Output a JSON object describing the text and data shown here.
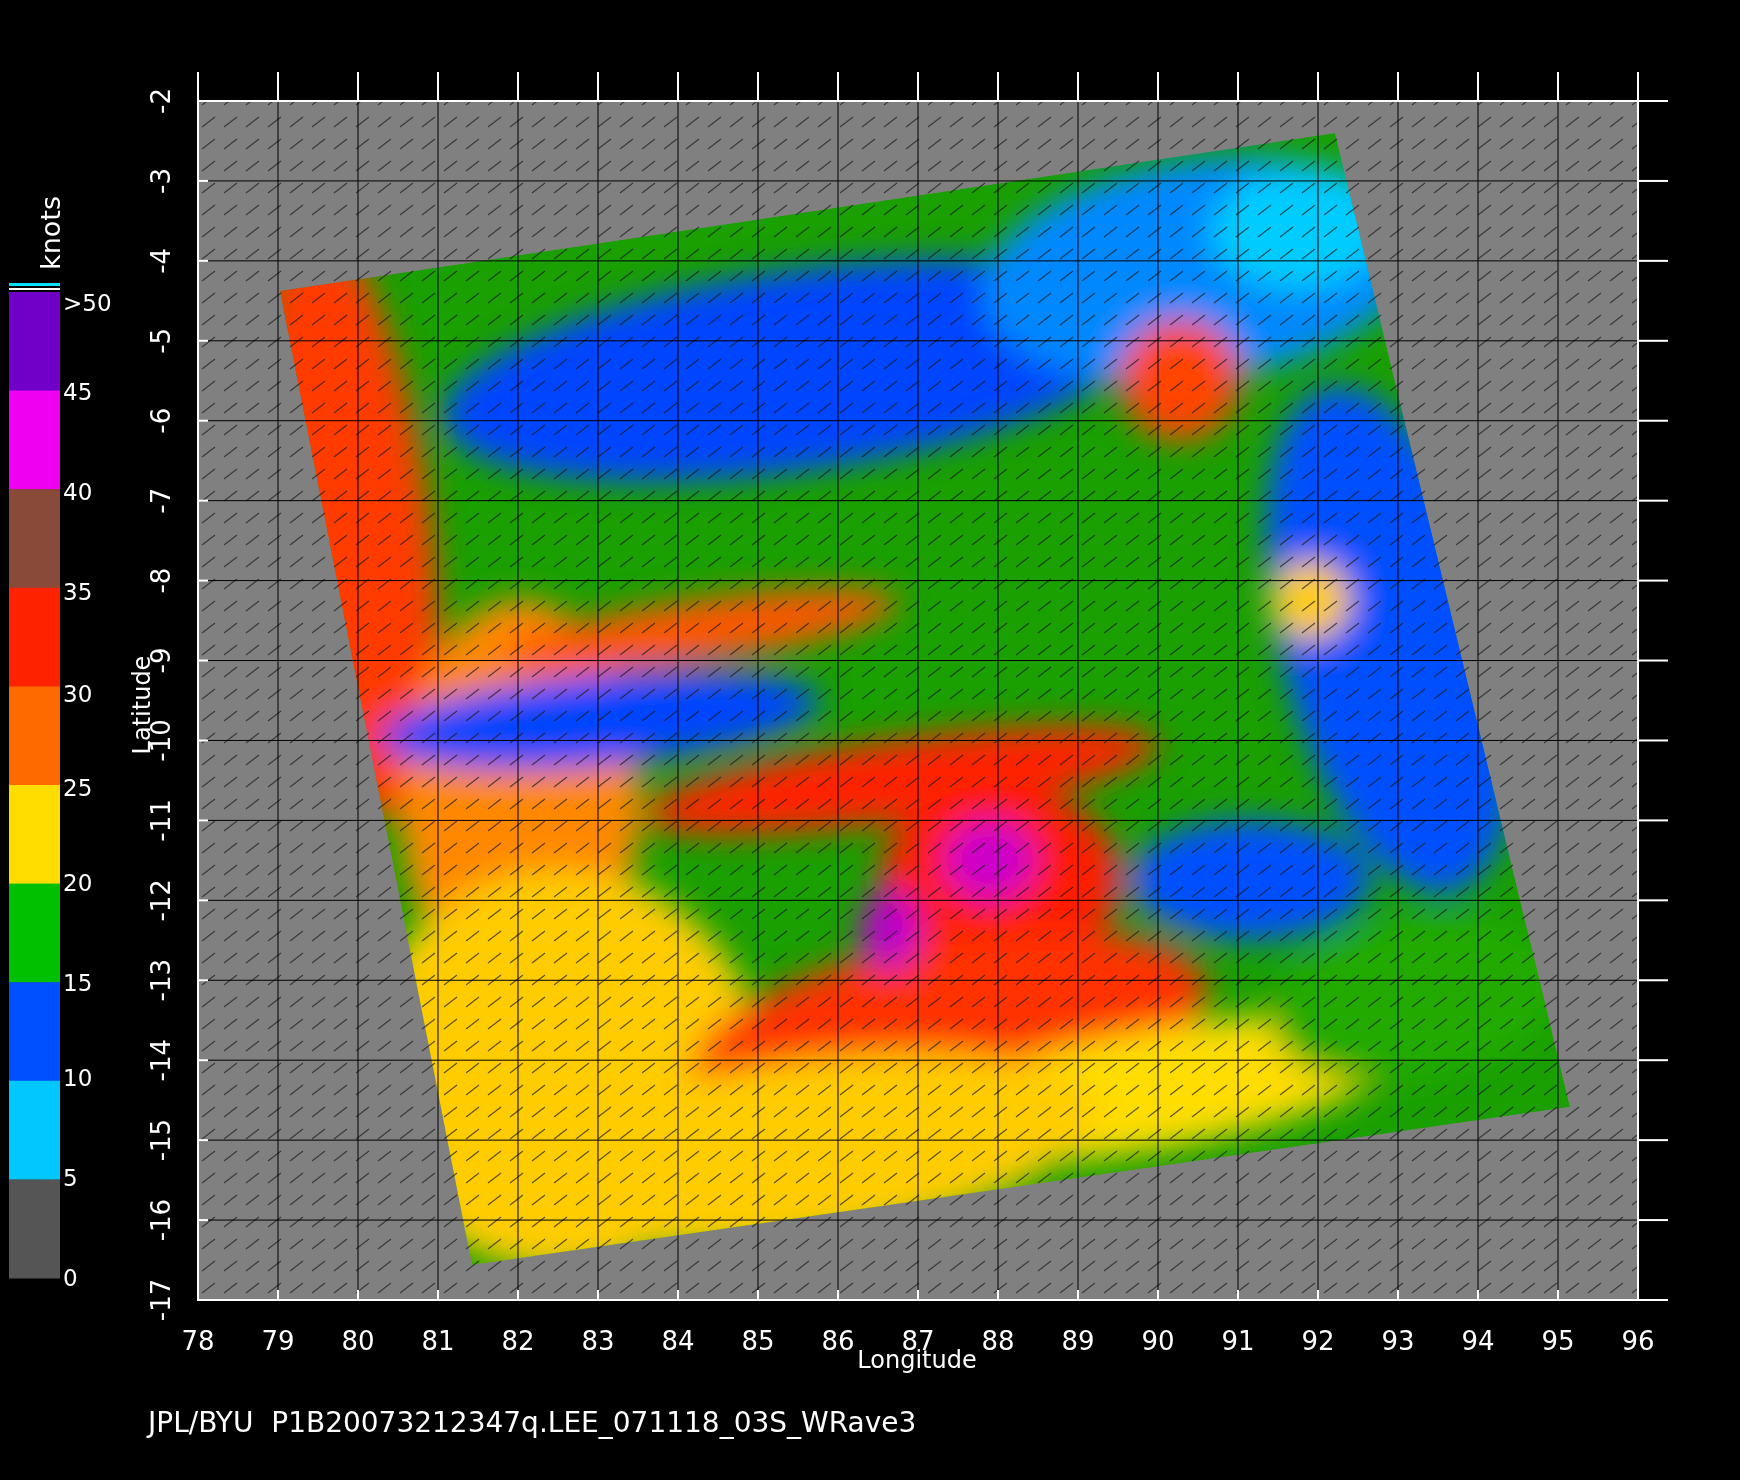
{
  "colorbar": {
    "unit": "knots",
    "labels": [
      ">50",
      "45",
      "40",
      "35",
      "30",
      "25",
      "20",
      "15",
      "10",
      "5",
      "0"
    ],
    "bands": [
      {
        "color": "#7000c8"
      },
      {
        "color": "#f000f0"
      },
      {
        "color": "#8a4a3a"
      },
      {
        "color": "#ff2200"
      },
      {
        "color": "#ff6a00"
      },
      {
        "color": "#ffdd00"
      },
      {
        "color": "#00c000"
      },
      {
        "color": "#0050ff"
      },
      {
        "color": "#00c8ff"
      },
      {
        "color": "#555555"
      }
    ]
  },
  "plot": {
    "xlabel": "Longitude",
    "ylabel": "Latitude",
    "xticks": [
      "78",
      "79",
      "80",
      "81",
      "82",
      "83",
      "84",
      "85",
      "86",
      "87",
      "88",
      "89",
      "90",
      "91",
      "92",
      "93",
      "94",
      "95",
      "96"
    ],
    "yticks": [
      "-2",
      "-3",
      "-4",
      "-5",
      "-6",
      "-7",
      "-8",
      "-9",
      "-10",
      "-11",
      "-12",
      "-13",
      "-14",
      "-15",
      "-16",
      "-17"
    ]
  },
  "footer": "JPL/BYU  P1B20073212347q.LEE_071118_03S_WRave3"
}
